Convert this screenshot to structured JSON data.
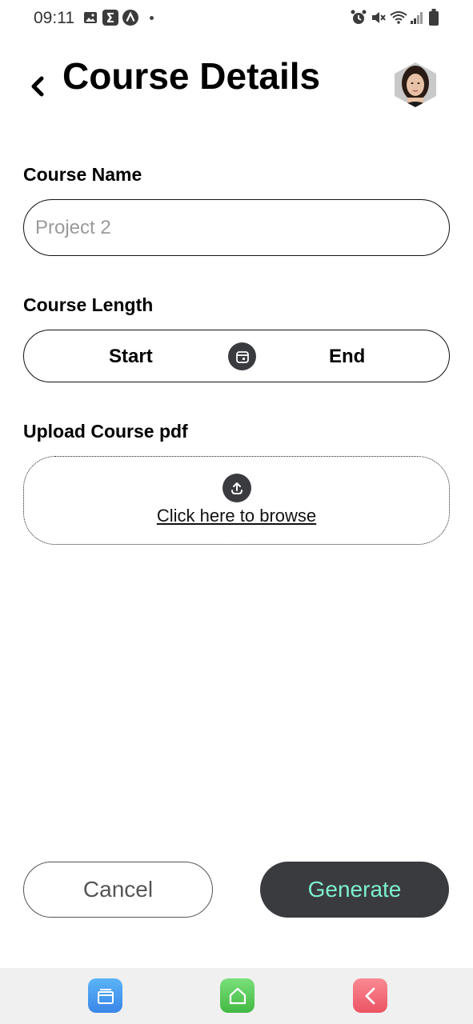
{
  "status_bar": {
    "time": "09:11",
    "left_icons": [
      "image-icon",
      "sigma-icon",
      "triangle-a-icon",
      "dot-icon"
    ],
    "right_icons": [
      "alarm-icon",
      "mute-icon",
      "wifi-icon",
      "signal-icon",
      "battery-icon"
    ]
  },
  "header": {
    "title": "Course Details",
    "back_icon": "chevron-left-icon",
    "avatar_icon": "profile-avatar"
  },
  "form": {
    "course_name": {
      "label": "Course Name",
      "placeholder": "Project 2",
      "value": ""
    },
    "course_length": {
      "label": "Course Length",
      "start_label": "Start",
      "end_label": "End",
      "icon": "calendar-icon"
    },
    "upload": {
      "label": "Upload Course pdf",
      "browse_text": "Click here to browse",
      "icon": "upload-icon"
    }
  },
  "actions": {
    "cancel_label": "Cancel",
    "generate_label": "Generate"
  },
  "nav_bar": {
    "items": [
      {
        "icon": "recent-apps-icon",
        "color": "#4a9ff0"
      },
      {
        "icon": "home-icon",
        "color": "#5ccf5c"
      },
      {
        "icon": "back-icon",
        "color": "#f06a78"
      }
    ]
  },
  "colors": {
    "accent_dark": "#3a3b3f",
    "generate_text": "#7ef0cc"
  }
}
